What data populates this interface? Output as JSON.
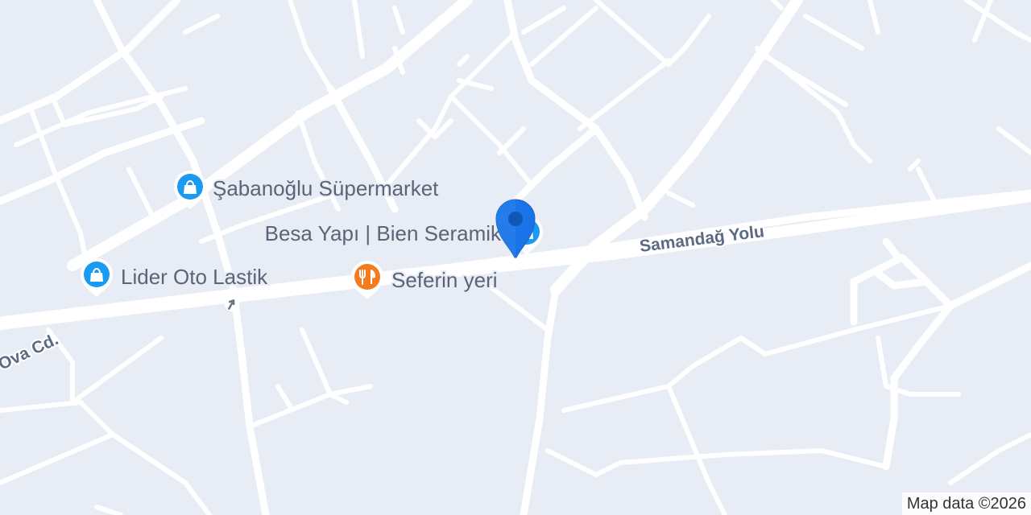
{
  "map": {
    "streets": {
      "samandag_yolu": "Samandağ Yolu",
      "ova_cd": "Ova Cd."
    },
    "pois": [
      {
        "id": "sabanoglu",
        "name": "Şabanoğlu Süpermarket",
        "category": "shopping-bag-icon",
        "color": "#1a9af0"
      },
      {
        "id": "lider",
        "name": "Lider Oto Lastik",
        "category": "shopping-bag-icon",
        "color": "#1a9af0"
      },
      {
        "id": "besa",
        "name": "Besa Yapı | Bien Seramik",
        "category": "shopping-bag-icon",
        "color": "#1a9af0"
      },
      {
        "id": "seferin",
        "name": "Seferin yeri",
        "category": "restaurant-icon",
        "color": "#f37b20"
      }
    ],
    "selected_pin_color": "#1a73e8",
    "attribution": "Map data ©2026"
  }
}
